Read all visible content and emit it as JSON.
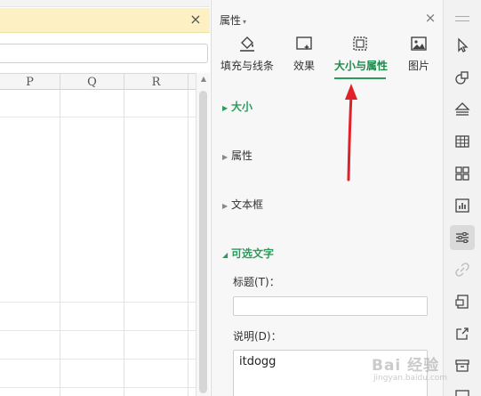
{
  "sheet": {
    "columns": [
      "P",
      "Q",
      "R"
    ],
    "notice_close": "×"
  },
  "panel": {
    "title": "属性",
    "title_caret": "▾",
    "close": "×",
    "tabs": [
      {
        "label": "填充与线条",
        "icon": "fill-line-icon"
      },
      {
        "label": "效果",
        "icon": "effects-icon"
      },
      {
        "label": "大小与属性",
        "icon": "size-properties-icon",
        "active": true
      },
      {
        "label": "图片",
        "icon": "picture-icon"
      }
    ],
    "sections": {
      "size": {
        "arrow": "▶",
        "title": "大小"
      },
      "properties": {
        "arrow": "▶",
        "title": "属性"
      },
      "textbox": {
        "arrow": "▶",
        "title": "文本框"
      },
      "alt_text": {
        "arrow": "◢",
        "title": "可选文字"
      }
    },
    "alt_title_label": "标题(T)：",
    "alt_title_value": "",
    "alt_desc_label": "说明(D)：",
    "alt_desc_value": "itdogg"
  },
  "toolbar": {
    "buttons": [
      "select-pointer-icon",
      "shapes-icon",
      "layers-icon",
      "table-icon",
      "grid-apps-icon",
      "chart-icon",
      "settings-sliders-icon",
      "link-icon",
      "pdf-icon",
      "share-icon",
      "archive-icon",
      "image-icon"
    ],
    "active": "settings-sliders-icon"
  },
  "watermark": {
    "main": "Bai 经验",
    "sub": "jingyan.baidu.com"
  },
  "colors": {
    "accent_green": "#2a9d5c",
    "annotation_red": "#e0202a",
    "notice_yellow": "#fdf1c3"
  }
}
